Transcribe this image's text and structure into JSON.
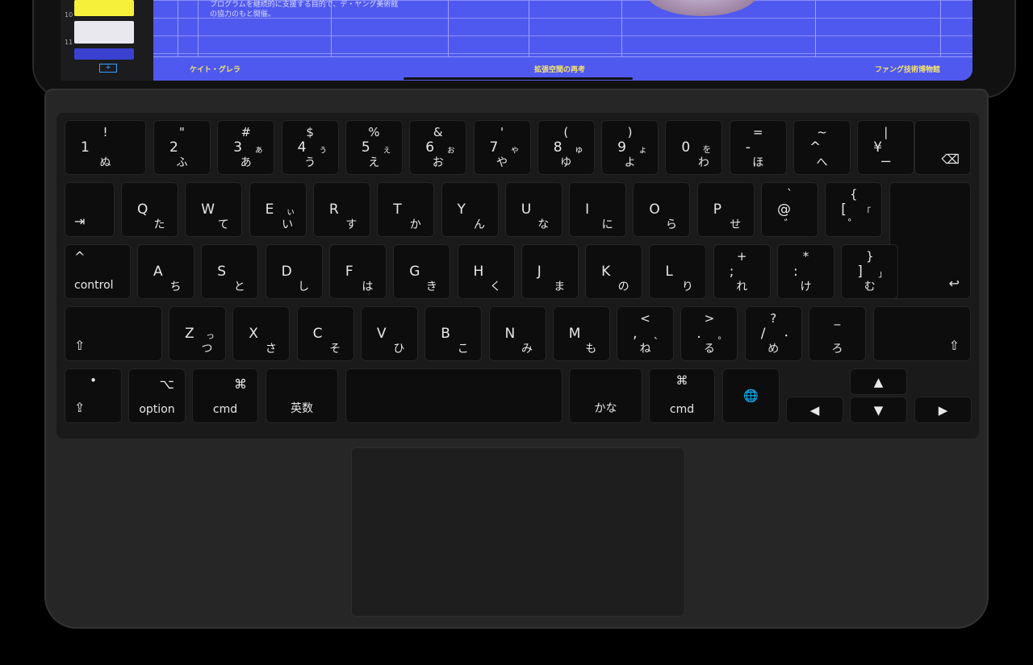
{
  "screen": {
    "sidebar": {
      "pages": [
        "10",
        "11"
      ]
    },
    "paragraph": [
      "プログラムを継続的に支援する目的で、デ・ヤング美術館",
      "の協力のもと開催。"
    ],
    "footer": [
      "ケイト・グレラ",
      "拡張空間の再考",
      "ファング技術博物館"
    ],
    "accent": "#5059ef"
  },
  "keyboard": {
    "rows": [
      [
        {
          "sym": "!",
          "main": "1",
          "kana": "ぬ"
        },
        {
          "sym": "\"",
          "main": "2",
          "kana": "ふ"
        },
        {
          "sym": "#",
          "main": "3",
          "ks": "ぁ",
          "kana": "あ"
        },
        {
          "sym": "$",
          "main": "4",
          "ks": "ぅ",
          "kana": "う"
        },
        {
          "sym": "%",
          "main": "5",
          "ks": "ぇ",
          "kana": "え"
        },
        {
          "sym": "&",
          "main": "6",
          "ks": "ぉ",
          "kana": "お"
        },
        {
          "sym": "'",
          "main": "7",
          "ks": "ゃ",
          "kana": "や"
        },
        {
          "sym": "(",
          "main": "8",
          "ks": "ゅ",
          "kana": "ゆ"
        },
        {
          "sym": ")",
          "main": "9",
          "ks": "ょ",
          "kana": "よ"
        },
        {
          "main": "0",
          "ks": "を",
          "kana": "わ"
        },
        {
          "sym": "=",
          "main": "-",
          "kana": "ほ"
        },
        {
          "sym": "~",
          "main": "^",
          "kana": "へ"
        },
        {
          "sym": "|",
          "main": "¥",
          "kana": "ー"
        },
        {
          "icon": "⌫",
          "name": "delete"
        }
      ],
      [
        {
          "iconbl": "⇥",
          "name": "tab"
        },
        {
          "main": "Q",
          "kana": "た"
        },
        {
          "main": "W",
          "kana": "て"
        },
        {
          "main": "E",
          "ks": "ぃ",
          "kana": "い"
        },
        {
          "main": "R",
          "kana": "す"
        },
        {
          "main": "T",
          "kana": "か"
        },
        {
          "main": "Y",
          "kana": "ん"
        },
        {
          "main": "U",
          "kana": "な"
        },
        {
          "main": "I",
          "kana": "に"
        },
        {
          "main": "O",
          "kana": "ら"
        },
        {
          "main": "P",
          "kana": "せ"
        },
        {
          "sym": "`",
          "main": "@",
          "kana": "゛"
        },
        {
          "sym": "{",
          "main": "[",
          "ks": "「",
          "kana": "゜"
        },
        {
          "name": "return",
          "icon": "↩"
        }
      ],
      [
        {
          "iconbl": "^",
          "label": "control",
          "name": "control"
        },
        {
          "main": "A",
          "kana": "ち"
        },
        {
          "main": "S",
          "kana": "と"
        },
        {
          "main": "D",
          "kana": "し"
        },
        {
          "main": "F",
          "kana": "は"
        },
        {
          "main": "G",
          "kana": "き"
        },
        {
          "main": "H",
          "kana": "く"
        },
        {
          "main": "J",
          "kana": "ま"
        },
        {
          "main": "K",
          "kana": "の"
        },
        {
          "main": "L",
          "kana": "り"
        },
        {
          "sym": "+",
          "main": ";",
          "kana": "れ"
        },
        {
          "sym": "*",
          "main": ":",
          "kana": "け"
        },
        {
          "sym": "}",
          "main": "]",
          "ks": "」",
          "kana": "む"
        }
      ],
      [
        {
          "iconbl": "⇧",
          "name": "shift-left"
        },
        {
          "main": "Z",
          "ks": "っ",
          "kana": "つ"
        },
        {
          "main": "X",
          "kana": "さ"
        },
        {
          "main": "C",
          "kana": "そ"
        },
        {
          "main": "V",
          "kana": "ひ"
        },
        {
          "main": "B",
          "kana": "こ"
        },
        {
          "main": "N",
          "kana": "み"
        },
        {
          "main": "M",
          "kana": "も"
        },
        {
          "sym": "<",
          "main": ",",
          "ks": "、",
          "kana": "ね"
        },
        {
          "sym": ">",
          "main": ".",
          "ks": "。",
          "kana": "る"
        },
        {
          "sym": "?",
          "main": "/",
          "ks": "・",
          "kana": "め"
        },
        {
          "sym": "_",
          "kana": "ろ"
        },
        {
          "icon": "⇧",
          "name": "shift-right"
        }
      ],
      [
        {
          "sym": "•",
          "iconbl": "⇪",
          "name": "fn"
        },
        {
          "icon": "⌥",
          "label": "option",
          "name": "option"
        },
        {
          "icon": "⌘",
          "label": "cmd",
          "name": "cmd-left"
        },
        {
          "label": "英数",
          "name": "eisu"
        },
        {
          "name": "space"
        },
        {
          "label": "かな",
          "name": "kana"
        },
        {
          "sym": "⌘",
          "label": "cmd",
          "name": "cmd-right"
        },
        {
          "center": "🌐",
          "name": "globe"
        },
        {
          "center": "◀",
          "name": "arrow-left"
        },
        {
          "center": "▲",
          "name": "arrow-up"
        },
        {
          "center": "▼",
          "name": "arrow-down"
        },
        {
          "center": "▶",
          "name": "arrow-right"
        }
      ]
    ]
  }
}
